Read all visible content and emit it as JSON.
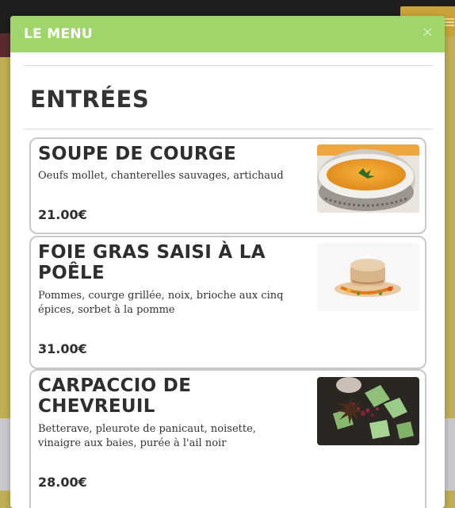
{
  "modal": {
    "title": "LE MENU",
    "close_label": "×"
  },
  "section": {
    "title": "ENTRÉES"
  },
  "dishes": [
    {
      "name": "SOUPE DE COURGE",
      "description": "Oeufs mollet, chanterelles sauvages, artichaud",
      "price": "21.00€",
      "photo": "squash-soup-photo"
    },
    {
      "name": "FOIE GRAS SAISI À LA POÊLE",
      "description": "Pommes, courge grillée, noix, brioche aux cinq épices, sorbet à la pomme",
      "price": "31.00€",
      "photo": "foie-gras-photo"
    },
    {
      "name": "CARPACCIO DE CHEVREUIL",
      "description": "Betterave, pleurote de panicaut, noisette, vinaigre aux baies, purée à l'ail noir",
      "price": "28.00€",
      "photo": "venison-carpaccio-photo"
    }
  ],
  "colors": {
    "header": "#9fd56b",
    "backdrop": "#bfae55",
    "text": "#2e2e2e"
  }
}
